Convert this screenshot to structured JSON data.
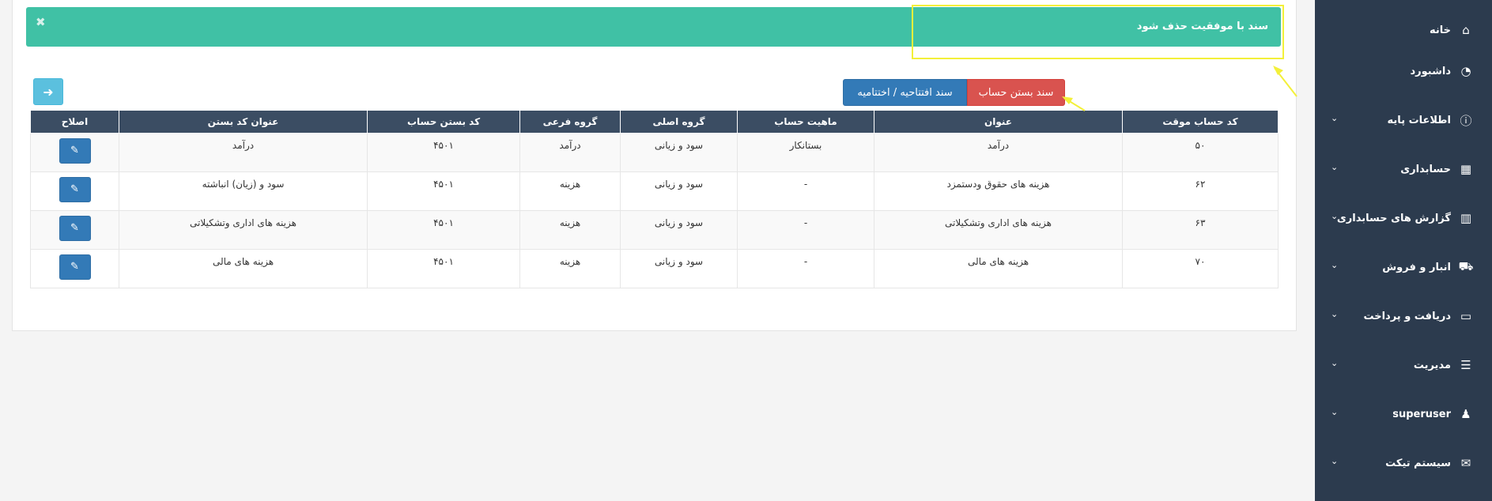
{
  "alert": {
    "message": "سند با موفقیت حذف شود",
    "close": "✖"
  },
  "toolbar": {
    "close_account_label": "سند بستن حساب",
    "opening_closing_label": "سند افتتاحیه / اختتامیه",
    "back_label": "➜"
  },
  "table": {
    "headers": [
      "کد حساب موقت",
      "عنوان",
      "ماهیت حساب",
      "گروه اصلی",
      "گروه فرعی",
      "کد بستن حساب",
      "عنوان کد بستن",
      "اصلاح"
    ],
    "rows": [
      [
        "۵۰",
        "درآمد",
        "بستانکار",
        "سود و زیانی",
        "درآمد",
        "۴۵۰۱",
        "درآمد"
      ],
      [
        "۶۲",
        "هزینه های حقوق ودستمزد",
        "-",
        "سود و زیانی",
        "هزینه",
        "۴۵۰۱",
        "سود و (زیان) انباشته"
      ],
      [
        "۶۳",
        "هزینه های اداری وتشکیلاتی",
        "-",
        "سود و زیانی",
        "هزینه",
        "۴۵۰۱",
        "هزینه های اداری وتشکیلاتی"
      ],
      [
        "۷۰",
        "هزینه های مالی",
        "-",
        "سود و زیانی",
        "هزینه",
        "۴۵۰۱",
        "هزینه های مالی"
      ]
    ]
  },
  "sidebar": {
    "items": [
      {
        "label": "خانه",
        "icon": "home-icon",
        "glyph": "⌂"
      },
      {
        "label": "داشبورد",
        "icon": "dashboard-icon",
        "glyph": "◔"
      },
      {
        "label": "اطلاعات پایه",
        "icon": "info-icon",
        "glyph": "ⓘ"
      },
      {
        "label": "حسابداری",
        "icon": "calculator-icon",
        "glyph": "▦"
      },
      {
        "label": "گزارش های حسابداری",
        "icon": "bar-chart-icon",
        "glyph": "▥"
      },
      {
        "label": "انبار و فروش",
        "icon": "cart-icon",
        "glyph": "⛟"
      },
      {
        "label": "دریافت و پرداخت",
        "icon": "credit-card-icon",
        "glyph": "▭"
      },
      {
        "label": "مدیریت",
        "icon": "server-icon",
        "glyph": "☰"
      },
      {
        "label": "superuser",
        "icon": "user-icon",
        "glyph": "♟"
      },
      {
        "label": "سیستم تیکت",
        "icon": "comments-icon",
        "glyph": "✉"
      }
    ],
    "chevron": "⌄"
  },
  "colors": {
    "sidebar_bg": "#2c3b4e",
    "alert_bg": "#40c1a5",
    "table_header_bg": "#3b4d63",
    "primary": "#337ab7",
    "danger": "#d9534f",
    "info": "#5bc0de",
    "annotation": "#f3f03a"
  }
}
